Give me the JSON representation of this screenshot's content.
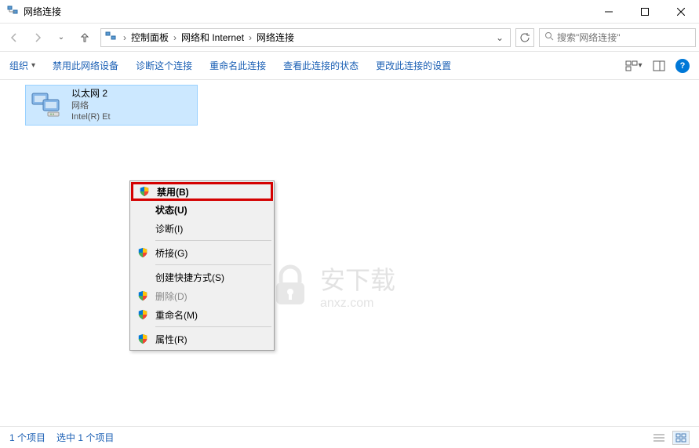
{
  "window": {
    "title": "网络连接"
  },
  "breadcrumb": {
    "items": [
      "控制面板",
      "网络和 Internet",
      "网络连接"
    ]
  },
  "search": {
    "placeholder": "搜索\"网络连接\""
  },
  "toolbar": {
    "organize": "组织",
    "items": [
      "禁用此网络设备",
      "诊断这个连接",
      "重命名此连接",
      "查看此连接的状态",
      "更改此连接的设置"
    ]
  },
  "network": {
    "name": "以太网 2",
    "status": "网络",
    "description": "Intel(R) Et"
  },
  "context_menu": {
    "items": [
      {
        "label": "禁用(B)",
        "shield": true,
        "disabled": false,
        "highlighted": true
      },
      {
        "label": "状态(U)",
        "shield": false,
        "disabled": false,
        "bold": true
      },
      {
        "label": "诊断(I)",
        "shield": false,
        "disabled": false
      },
      {
        "sep": true
      },
      {
        "label": "桥接(G)",
        "shield": true,
        "disabled": false
      },
      {
        "sep": true
      },
      {
        "label": "创建快捷方式(S)",
        "shield": false,
        "disabled": false
      },
      {
        "label": "删除(D)",
        "shield": true,
        "disabled": true
      },
      {
        "label": "重命名(M)",
        "shield": true,
        "disabled": false
      },
      {
        "sep": true
      },
      {
        "label": "属性(R)",
        "shield": true,
        "disabled": false
      }
    ]
  },
  "statusbar": {
    "item_count": "1 个项目",
    "selected": "选中 1 个项目"
  },
  "watermark": {
    "main": "安下载",
    "sub": "anxz.com"
  }
}
